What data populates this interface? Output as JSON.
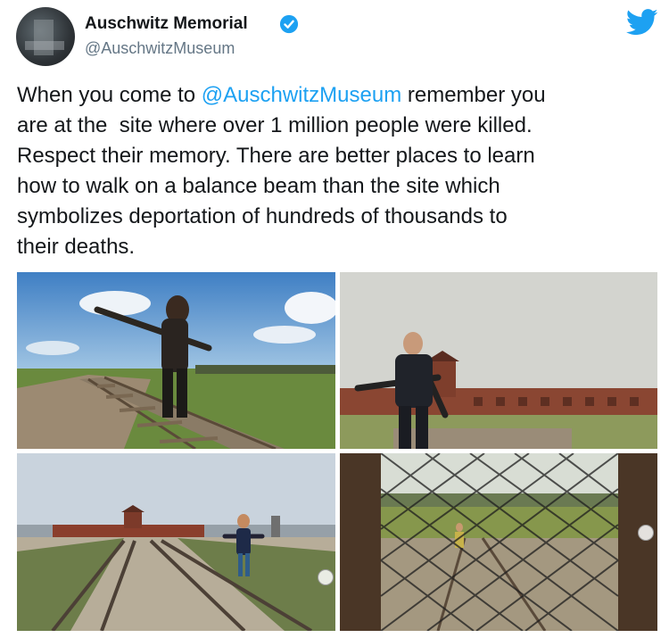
{
  "account": {
    "display_name": "Auschwitz Memorial",
    "handle": "@AuschwitzMuseum",
    "verified": true,
    "avatar_icon": "avatar-photo"
  },
  "tweet": {
    "text_before": "When you come to ",
    "mention": "@AuschwitzMuseum",
    "text_after": " remember you\nare at the  site where over 1 million people were killed.\nRespect their memory. There are better places to learn\nhow to walk on a balance beam than the site which\nsymbolizes deportation of hundreds of thousands to\ntheir deaths."
  },
  "icons": {
    "brand": "twitter-bird-icon",
    "verified": "verified-badge-icon"
  },
  "colors": {
    "brand_blue": "#1da1f2",
    "text": "#14171a",
    "secondary": "#657786"
  },
  "photos": [
    {
      "name": "photo-woman-balancing-on-rails"
    },
    {
      "name": "photo-man-on-rails-gatehouse"
    },
    {
      "name": "photo-woman-rails-gatehouse-distance"
    },
    {
      "name": "photo-fence-view-rails"
    }
  ]
}
